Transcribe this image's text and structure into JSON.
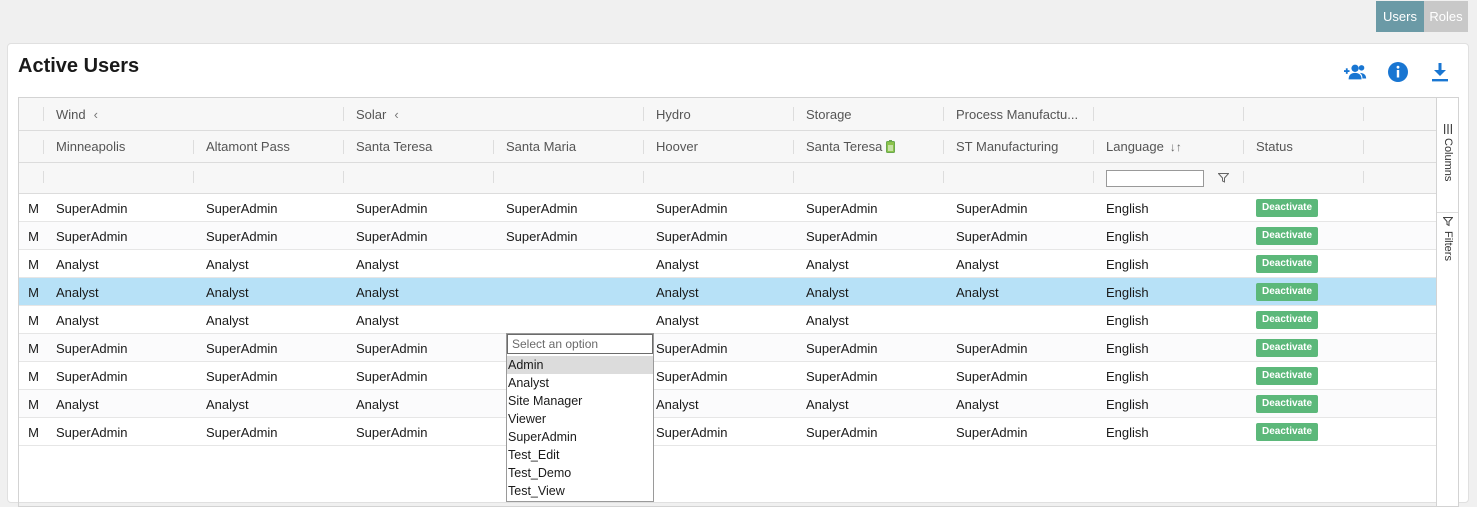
{
  "toggle": {
    "users": "Users",
    "roles": "Roles"
  },
  "card": {
    "title": "Active Users"
  },
  "groups": [
    "Wind",
    "Solar",
    "Hydro",
    "Storage",
    "Process Manufactu..."
  ],
  "columns": {
    "first_partial": "M",
    "minneapolis": "Minneapolis",
    "altamont": "Altamont Pass",
    "santa_teresa_solar": "Santa Teresa",
    "santa_maria": "Santa Maria",
    "hoover": "Hoover",
    "santa_teresa_storage": "Santa Teresa",
    "st_manufacturing": "ST Manufacturing",
    "language": "Language",
    "status": "Status"
  },
  "rows": [
    [
      "M",
      "SuperAdmin",
      "SuperAdmin",
      "SuperAdmin",
      "SuperAdmin",
      "SuperAdmin",
      "SuperAdmin",
      "SuperAdmin",
      "English",
      "Deactivate"
    ],
    [
      "M",
      "SuperAdmin",
      "SuperAdmin",
      "SuperAdmin",
      "SuperAdmin",
      "SuperAdmin",
      "SuperAdmin",
      "SuperAdmin",
      "English",
      "Deactivate"
    ],
    [
      "M",
      "Analyst",
      "Analyst",
      "Analyst",
      "",
      "Analyst",
      "Analyst",
      "Analyst",
      "English",
      "Deactivate"
    ],
    [
      "M",
      "Analyst",
      "Analyst",
      "Analyst",
      "",
      "Analyst",
      "Analyst",
      "Analyst",
      "English",
      "Deactivate"
    ],
    [
      "M",
      "Analyst",
      "Analyst",
      "Analyst",
      "",
      "Analyst",
      "Analyst",
      "",
      "English",
      "Deactivate"
    ],
    [
      "M",
      "SuperAdmin",
      "SuperAdmin",
      "SuperAdmin",
      "",
      "SuperAdmin",
      "SuperAdmin",
      "SuperAdmin",
      "English",
      "Deactivate"
    ],
    [
      "M",
      "SuperAdmin",
      "SuperAdmin",
      "SuperAdmin",
      "",
      "SuperAdmin",
      "SuperAdmin",
      "SuperAdmin",
      "English",
      "Deactivate"
    ],
    [
      "M",
      "Analyst",
      "Analyst",
      "Analyst",
      "",
      "Analyst",
      "Analyst",
      "Analyst",
      "English",
      "Deactivate"
    ],
    [
      "M",
      "SuperAdmin",
      "SuperAdmin",
      "SuperAdmin",
      "",
      "SuperAdmin",
      "SuperAdmin",
      "SuperAdmin",
      "English",
      "Deactivate"
    ]
  ],
  "selected_row": 3,
  "dropdown": {
    "placeholder": "Select an option",
    "options": [
      "Admin",
      "Analyst",
      "Site Manager",
      "Viewer",
      "SuperAdmin",
      "Test_Edit",
      "Test_Demo",
      "Test_View"
    ],
    "highlighted": 0
  },
  "sidebar": {
    "columns": "Columns",
    "filters": "Filters"
  },
  "colors": {
    "accent": "#1976d2",
    "badge": "#5cb87a",
    "selected_row": "#b7e1f7",
    "toggle_active": "#6b9aa6"
  },
  "icons": {
    "add_user": "add-user-icon",
    "info": "info-icon",
    "download": "download-icon"
  }
}
